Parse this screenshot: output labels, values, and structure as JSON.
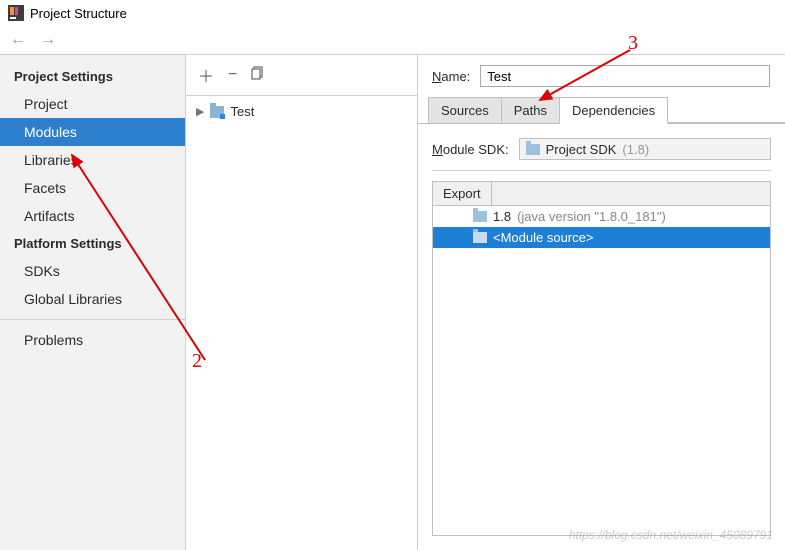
{
  "window": {
    "title": "Project Structure"
  },
  "sidebar": {
    "heading1": "Project Settings",
    "items1": [
      {
        "label": "Project"
      },
      {
        "label": "Modules",
        "selected": true
      },
      {
        "label": "Libraries"
      },
      {
        "label": "Facets"
      },
      {
        "label": "Artifacts"
      }
    ],
    "heading2": "Platform Settings",
    "items2": [
      {
        "label": "SDKs"
      },
      {
        "label": "Global Libraries"
      }
    ],
    "items3": [
      {
        "label": "Problems"
      }
    ]
  },
  "middle": {
    "tree": [
      {
        "label": "Test"
      }
    ]
  },
  "detail": {
    "name_label": "Name:",
    "name_value": "Test",
    "tabs": [
      {
        "label": "Sources"
      },
      {
        "label": "Paths"
      },
      {
        "label": "Dependencies",
        "active": true
      }
    ],
    "sdk_label": "Module SDK:",
    "sdk_value": "Project SDK",
    "sdk_hint": "(1.8)",
    "export_label": "Export",
    "deps": [
      {
        "label": "1.8",
        "hint": "(java version \"1.8.0_181\")"
      },
      {
        "label": "<Module source>",
        "selected": true
      }
    ]
  },
  "annotations": {
    "n2": "2",
    "n3": "3"
  },
  "watermark": "https://blog.csdn.net/weixin_45089791"
}
